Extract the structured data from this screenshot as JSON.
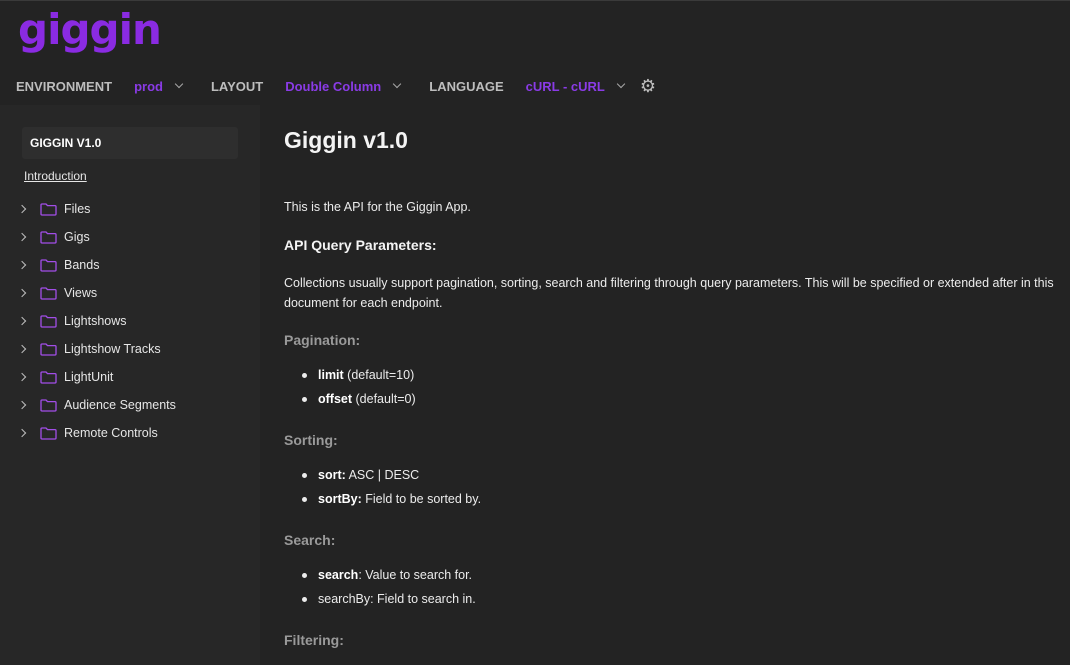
{
  "app": {
    "logo": "giggin",
    "accent": "#8a2be2"
  },
  "topbar": {
    "environment_label": "ENVIRONMENT",
    "environment_value": "prod",
    "layout_label": "LAYOUT",
    "layout_value": "Double Column",
    "language_label": "LANGUAGE",
    "language_value": "cURL - cURL",
    "settings_icon": "gear-icon"
  },
  "sidebar": {
    "title": "GIGGIN V1.0",
    "intro_link": "Introduction",
    "items": [
      {
        "label": "Files"
      },
      {
        "label": "Gigs"
      },
      {
        "label": "Bands"
      },
      {
        "label": "Views"
      },
      {
        "label": "Lightshows"
      },
      {
        "label": "Lightshow Tracks"
      },
      {
        "label": "LightUnit"
      },
      {
        "label": "Audience Segments"
      },
      {
        "label": "Remote Controls"
      }
    ]
  },
  "content": {
    "title": "Giggin v1.0",
    "intro": "This is the API for the Giggin App.",
    "query_heading": "API Query Parameters:",
    "query_paragraph": "Collections usually support pagination, sorting, search and filtering through query parameters. This will be specified or extended after in this document for each endpoint.",
    "pagination": {
      "heading": "Pagination:",
      "items": [
        {
          "key": "limit",
          "text": " (default=10)"
        },
        {
          "key": "offset",
          "text": " (default=0)"
        }
      ]
    },
    "sorting": {
      "heading": "Sorting:",
      "items": [
        {
          "key": "sort:",
          "text": " ASC | DESC"
        },
        {
          "key": "sortBy:",
          "text": " Field to be sorted by."
        }
      ]
    },
    "search": {
      "heading": "Search:",
      "items": [
        {
          "key": "search",
          "text": ": Value to search for."
        },
        {
          "key": "",
          "text": "searchBy: Field to search in."
        }
      ]
    },
    "filtering": {
      "heading": "Filtering:"
    }
  }
}
